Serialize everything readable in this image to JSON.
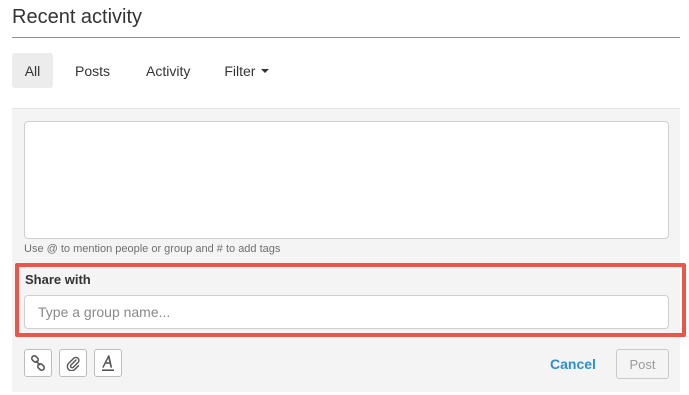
{
  "header": {
    "title": "Recent activity"
  },
  "tabs": [
    {
      "label": "All",
      "active": true
    },
    {
      "label": "Posts",
      "active": false
    },
    {
      "label": "Activity",
      "active": false
    },
    {
      "label": "Filter",
      "active": false,
      "has_dropdown": true
    }
  ],
  "composer": {
    "post_value": "",
    "hint": "Use @ to mention people or group and # to add tags",
    "share": {
      "label": "Share with",
      "placeholder": "Type a group name...",
      "value": "",
      "highlighted": true,
      "highlight_color": "#e9564b"
    },
    "toolbar": {
      "icons": [
        "link-icon",
        "paperclip-icon",
        "text-format-icon"
      ]
    },
    "cancel_label": "Cancel",
    "post_label": "Post",
    "post_enabled": false
  },
  "colors": {
    "accent": "#45a7dc",
    "link": "#2e8fd0",
    "highlight": "#e9564b"
  }
}
